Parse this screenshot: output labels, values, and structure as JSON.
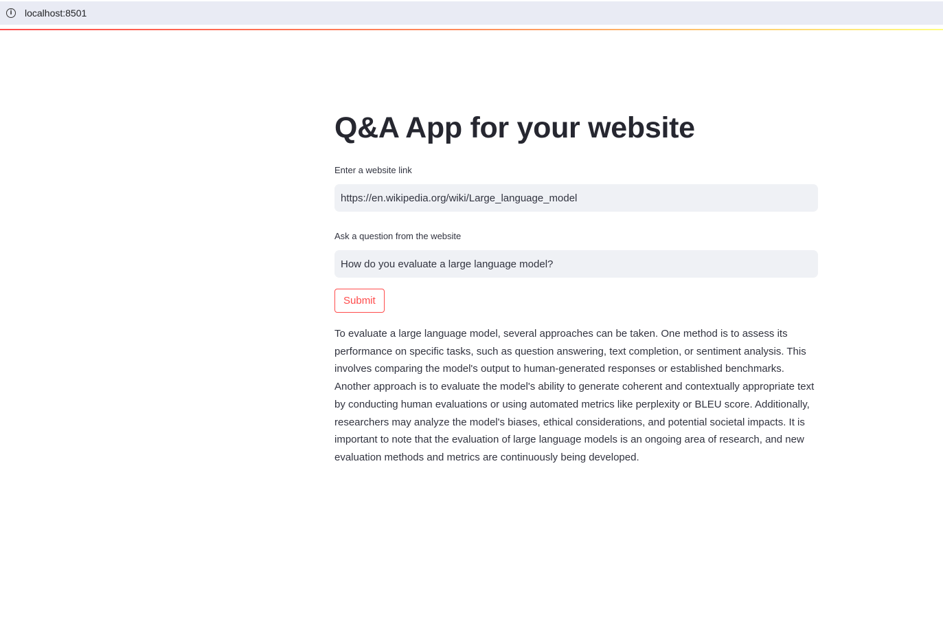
{
  "browser": {
    "url": "localhost:8501",
    "info_icon": "info-icon"
  },
  "colors": {
    "accent": "#ff4b4b",
    "input_bg": "#eff1f5",
    "text": "#31333f"
  },
  "main": {
    "title": "Q&A App for your website",
    "website_field": {
      "label": "Enter a website link",
      "value": "https://en.wikipedia.org/wiki/Large_language_model"
    },
    "question_field": {
      "label": "Ask a question from the website",
      "value": "How do you evaluate a large language model?"
    },
    "submit_label": "Submit",
    "answer": "To evaluate a large language model, several approaches can be taken. One method is to assess its performance on specific tasks, such as question answering, text completion, or sentiment analysis. This involves comparing the model's output to human-generated responses or established benchmarks. Another approach is to evaluate the model's ability to generate coherent and contextually appropriate text by conducting human evaluations or using automated metrics like perplexity or BLEU score. Additionally, researchers may analyze the model's biases, ethical considerations, and potential societal impacts. It is important to note that the evaluation of large language models is an ongoing area of research, and new evaluation methods and metrics are continuously being developed."
  }
}
